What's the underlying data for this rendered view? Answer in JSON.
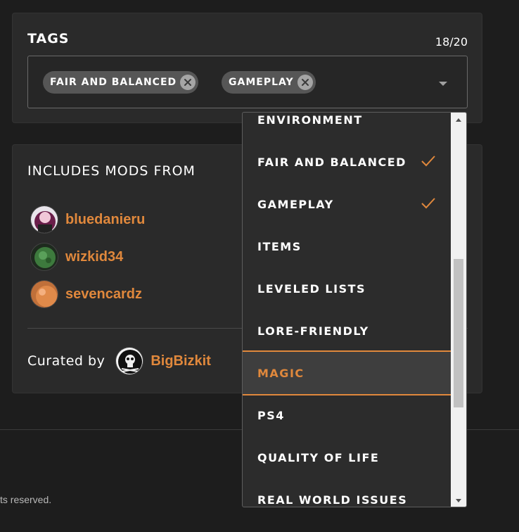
{
  "tags": {
    "title": "TAGS",
    "count": "18/20",
    "selected": [
      {
        "label": "FAIR AND BALANCED"
      },
      {
        "label": "GAMEPLAY"
      }
    ]
  },
  "mods": {
    "title": "INCLUDES MODS FROM",
    "authors": [
      {
        "name": "bluedanieru"
      },
      {
        "name": "wizkid34"
      },
      {
        "name": "sevencardz"
      }
    ],
    "curated_label": "Curated by",
    "curator": "BigBizkit"
  },
  "footer": {
    "text": "ts reserved."
  },
  "dropdown": {
    "items": [
      {
        "label": "ENVIRONMENT",
        "checked": false
      },
      {
        "label": "FAIR AND BALANCED",
        "checked": true
      },
      {
        "label": "GAMEPLAY",
        "checked": true
      },
      {
        "label": "ITEMS",
        "checked": false
      },
      {
        "label": "LEVELED LISTS",
        "checked": false
      },
      {
        "label": "LORE-FRIENDLY",
        "checked": false
      },
      {
        "label": "MAGIC",
        "checked": false,
        "highlighted": true
      },
      {
        "label": "PS4",
        "checked": false
      },
      {
        "label": "QUALITY OF LIFE",
        "checked": false
      },
      {
        "label": "REAL WORLD ISSUES",
        "checked": false
      }
    ]
  },
  "colors": {
    "accent": "#e0883c",
    "background": "#1d1d1d",
    "card": "#2a2a2a"
  },
  "icons": [
    "remove-tag-icon",
    "chevron-down-icon",
    "checkmark-icon",
    "scroll-up-arrow-icon",
    "scroll-down-arrow-icon"
  ]
}
